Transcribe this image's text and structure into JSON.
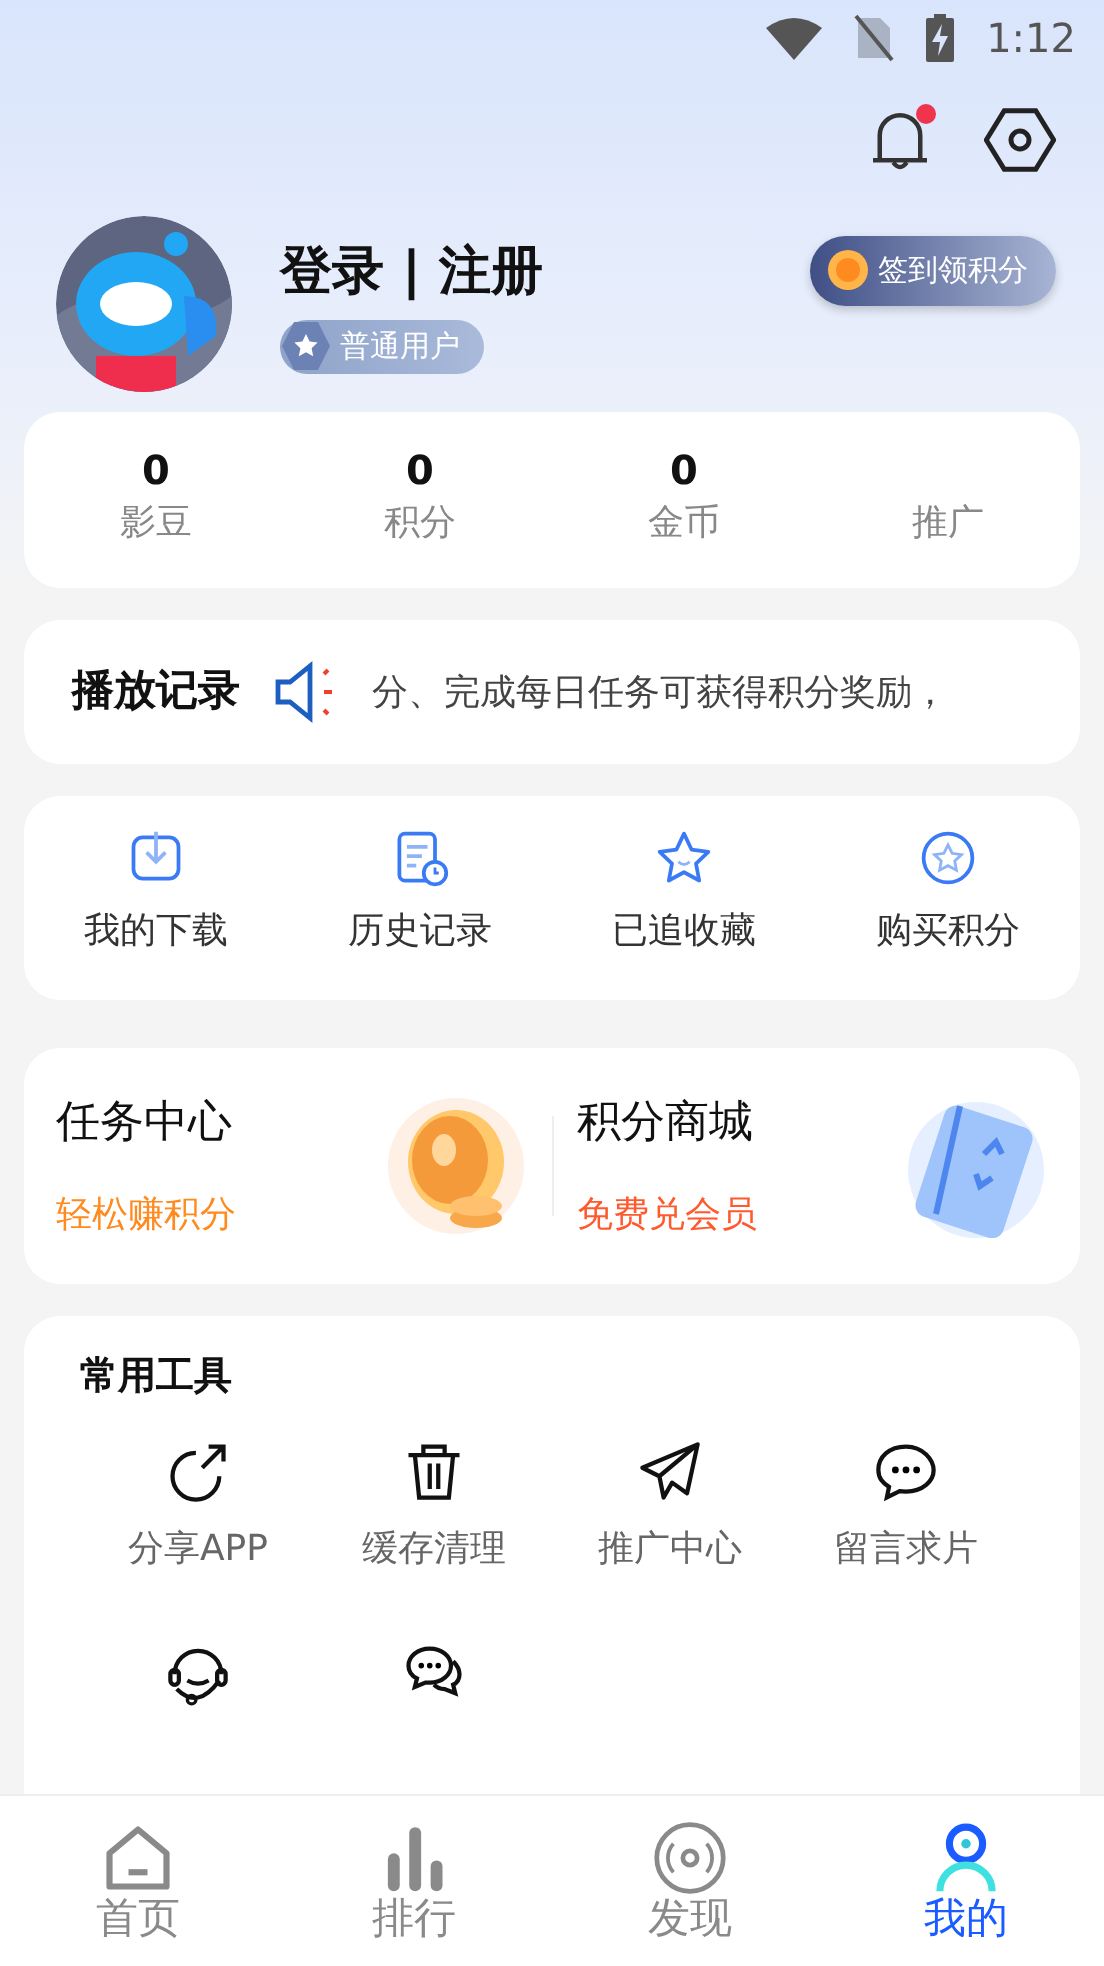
{
  "status_bar": {
    "time": "1:12"
  },
  "header": {
    "notification_unread": true
  },
  "profile": {
    "login": "登录 | 注册",
    "level": "普通用户",
    "checkin_button": "签到领积分"
  },
  "stats": [
    {
      "value": "0",
      "label": "影豆"
    },
    {
      "value": "0",
      "label": "积分"
    },
    {
      "value": "0",
      "label": "金币"
    },
    {
      "label": "推广"
    }
  ],
  "notice": {
    "title": "播放记录",
    "text": "分、完成每日任务可获得积分奖励，"
  },
  "shortcuts": [
    "我的下载",
    "历史记录",
    "已追收藏",
    "购买积分"
  ],
  "promos": [
    {
      "title": "任务中心",
      "subtitle": "轻松赚积分",
      "color": "#ff8a1f"
    },
    {
      "title": "积分商城",
      "subtitle": "免费兑会员",
      "color": "#ff5a2e"
    }
  ],
  "tools": {
    "title": "常用工具",
    "items": [
      {
        "kind": "labeled",
        "label": "分享APP"
      },
      {
        "kind": "labeled",
        "label": "缓存清理"
      },
      {
        "kind": "labeled",
        "label": "推广中心"
      },
      {
        "kind": "labeled",
        "label": "留言求片"
      },
      {
        "kind": "icon_only"
      },
      {
        "kind": "icon_only"
      }
    ]
  },
  "nav": [
    {
      "label": "首页",
      "selected": false
    },
    {
      "label": "排行",
      "selected": false
    },
    {
      "label": "发现",
      "selected": false
    },
    {
      "label": "我的",
      "selected": true
    }
  ]
}
